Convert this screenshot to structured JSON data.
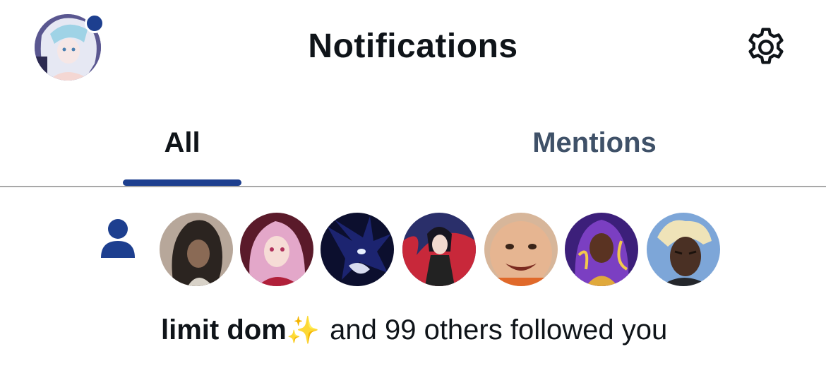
{
  "header": {
    "title": "Notifications",
    "profile_avatar_label": "profile-avatar",
    "has_unread_dot": true,
    "settings_icon": "gear-icon"
  },
  "tabs": [
    {
      "label": "All",
      "selected": true
    },
    {
      "label": "Mentions",
      "selected": false
    }
  ],
  "colors": {
    "accent": "#1d3f8f",
    "text_primary": "#0f1419",
    "text_secondary": "#3f5168"
  },
  "notification": {
    "type_icon": "person-icon",
    "follower_avatars": [
      {
        "icon": "avatar-anime-dark-hair"
      },
      {
        "icon": "avatar-anime-pink-hair"
      },
      {
        "icon": "avatar-dark-hedgehog"
      },
      {
        "icon": "avatar-anime-red-splash"
      },
      {
        "icon": "avatar-smiling-child"
      },
      {
        "icon": "avatar-purple-hooded"
      },
      {
        "icon": "avatar-blond-dreads"
      }
    ],
    "actor_name": "limit dom",
    "actor_emoji": "✨",
    "message": "and 99 others followed you"
  }
}
